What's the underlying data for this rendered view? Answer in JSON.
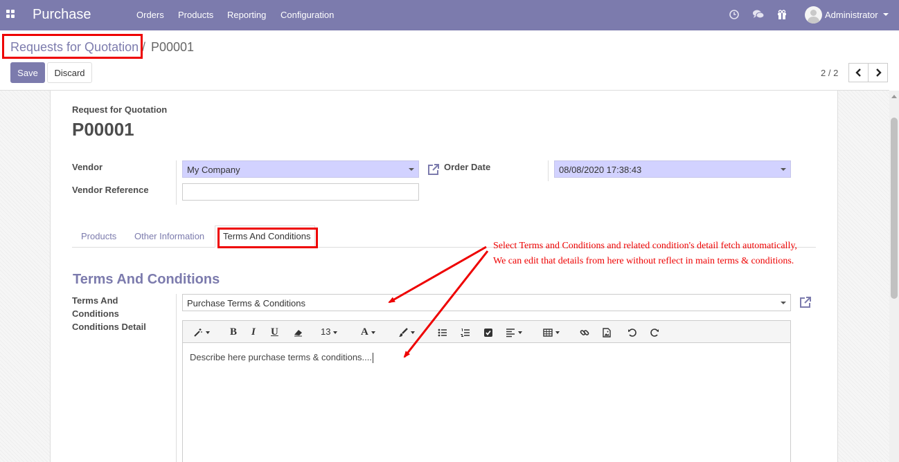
{
  "navbar": {
    "app_name": "Purchase",
    "menu": [
      "Orders",
      "Products",
      "Reporting",
      "Configuration"
    ],
    "icons": [
      "apps-grid-icon",
      "clock-icon",
      "chat-icon",
      "gift-icon"
    ],
    "user_name": "Administrator",
    "color": "#7c7bad"
  },
  "breadcrumb": {
    "parent": "Requests for Quotation",
    "separator": "/",
    "current": "P00001"
  },
  "buttons": {
    "save": "Save",
    "discard": "Discard"
  },
  "pager": {
    "value": "2 / 2",
    "prev_icon": "chevron-left-icon",
    "next_icon": "chevron-right-icon"
  },
  "form": {
    "subtitle": "Request for Quotation",
    "title": "P00001",
    "vendor_label": "Vendor",
    "vendor_value": "My Company",
    "vendor_ref_label": "Vendor Reference",
    "vendor_ref_value": "",
    "order_date_label": "Order Date",
    "order_date_value": "08/08/2020 17:38:43"
  },
  "tabs": [
    {
      "label": "Products",
      "active": false
    },
    {
      "label": "Other Information",
      "active": false
    },
    {
      "label": "Terms And Conditions",
      "active": true
    }
  ],
  "annotation": {
    "line1": "Select Terms and Conditions and related condition's detail fetch automatically,",
    "line2": "We can edit that details from here without reflect in main terms & conditions.",
    "color": "#ee0000"
  },
  "terms": {
    "section_title": "Terms And Conditions",
    "terms_label_line1": "Terms And",
    "terms_label_line2": "Conditions",
    "terms_value": "Purchase Terms & Conditions",
    "detail_label": "Conditions Detail",
    "editor_text": "Describe here purchase terms & conditions....",
    "font_size": "13",
    "toolbar_icons": [
      "magic-wand-icon",
      "bold-icon",
      "italic-icon",
      "underline-icon",
      "eraser-icon",
      "font-size-dropdown",
      "font-color-icon",
      "paint-brush-icon",
      "bullet-list-icon",
      "numbered-list-icon",
      "checklist-icon",
      "align-icon",
      "table-icon",
      "link-icon",
      "image-icon",
      "undo-icon",
      "redo-icon"
    ]
  }
}
